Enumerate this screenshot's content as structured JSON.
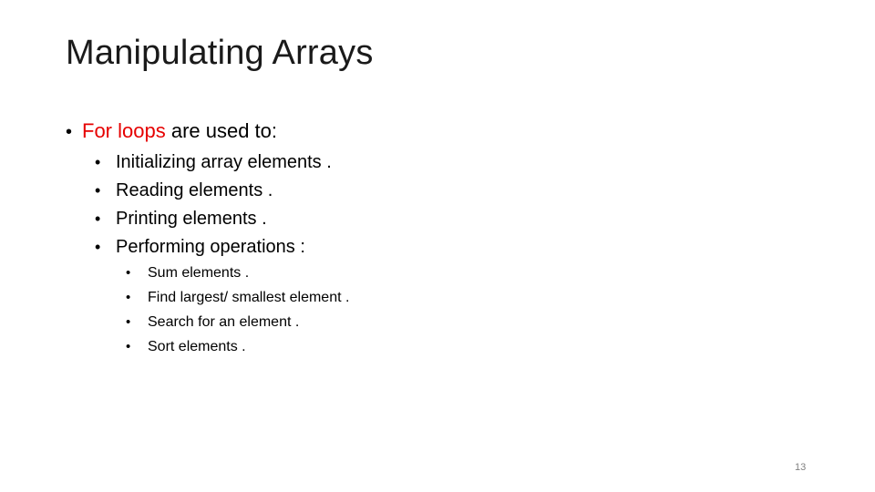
{
  "slide": {
    "title": "Manipulating Arrays",
    "main_point": {
      "bullet": "•",
      "emphasis": "For loops",
      "rest": " are used to:",
      "emphasis_color": "#e60000"
    },
    "uses": [
      {
        "bullet": "•",
        "text": "Initializing array elements ."
      },
      {
        "bullet": "•",
        "text": "Reading elements ."
      },
      {
        "bullet": "•",
        "text": "Printing elements ."
      },
      {
        "bullet": "•",
        "text": "Performing operations :"
      }
    ],
    "operations": [
      {
        "bullet": "•",
        "text": "Sum elements ."
      },
      {
        "bullet": "•",
        "text": "Find largest/ smallest element ."
      },
      {
        "bullet": "•",
        "text": "Search for an element ."
      },
      {
        "bullet": "•",
        "text": "Sort elements ."
      }
    ],
    "page_number": "13"
  }
}
